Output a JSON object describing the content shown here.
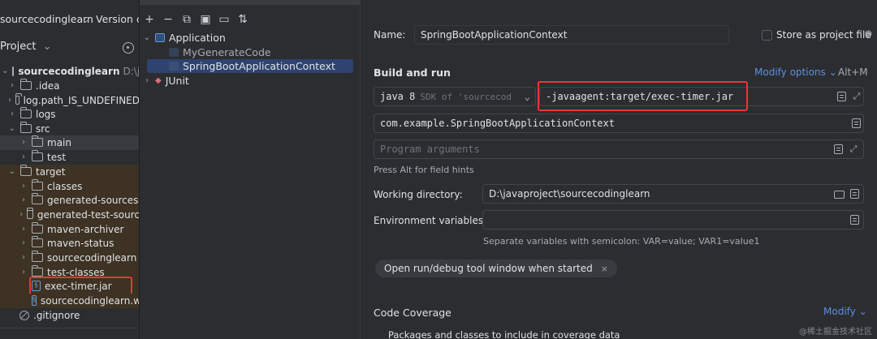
{
  "top_tabs": {
    "project_name": "sourcecodinglearn",
    "version_control": "Version c"
  },
  "project_panel": {
    "title": "Project",
    "root": {
      "name": "sourcecodinglearn",
      "path": "D:\\jav"
    },
    "items": [
      {
        "label": ".idea"
      },
      {
        "label": "log.path_IS_UNDEFINED"
      },
      {
        "label": "logs"
      },
      {
        "label": "src"
      },
      {
        "label": "main"
      },
      {
        "label": "test"
      },
      {
        "label": "target"
      },
      {
        "label": "classes"
      },
      {
        "label": "generated-sources"
      },
      {
        "label": "generated-test-sourc"
      },
      {
        "label": "maven-archiver"
      },
      {
        "label": "maven-status"
      },
      {
        "label": "sourcecodinglearn"
      },
      {
        "label": "test-classes"
      },
      {
        "label": "exec-timer.jar"
      },
      {
        "label": "sourcecodinglearn.w"
      },
      {
        "label": ".gitignore"
      }
    ]
  },
  "configs": {
    "application": "Application",
    "my_generate_code": "MyGenerateCode",
    "spring_boot_context": "SpringBootApplicationContext",
    "junit": "JUnit"
  },
  "form": {
    "name_label": "Name:",
    "name_value": "SpringBootApplicationContext",
    "store_label": "Store as project file",
    "build_run_title": "Build and run",
    "modify_options": "Modify options",
    "modify_shortcut": "Alt+M",
    "jdk_name": "java 8",
    "jdk_hint": "SDK of 'sourcecod",
    "vm_options": "-javaagent:target/exec-timer.jar",
    "main_class": "com.example.SpringBootApplicationContext",
    "program_args_placeholder": "Program arguments",
    "field_hint": "Press Alt for field hints",
    "workdir_label": "Working directory:",
    "workdir_value": "D:\\javaproject\\sourcecodinglearn",
    "env_label": "Environment variables:",
    "env_hint": "Separate variables with semicolon: VAR=value; VAR1=value1",
    "chip_label": "Open run/debug tool window when started",
    "code_coverage_title": "Code Coverage",
    "modify_link": "Modify",
    "coverage_sub": "Packages and classes to include in coverage data"
  },
  "watermark": "@稀土掘金技术社区",
  "colors": {
    "accent_link": "#5e8fe2",
    "selection": "#2e436e",
    "highlight_box": "#e53935",
    "excluded_bg": "#3d3223"
  }
}
